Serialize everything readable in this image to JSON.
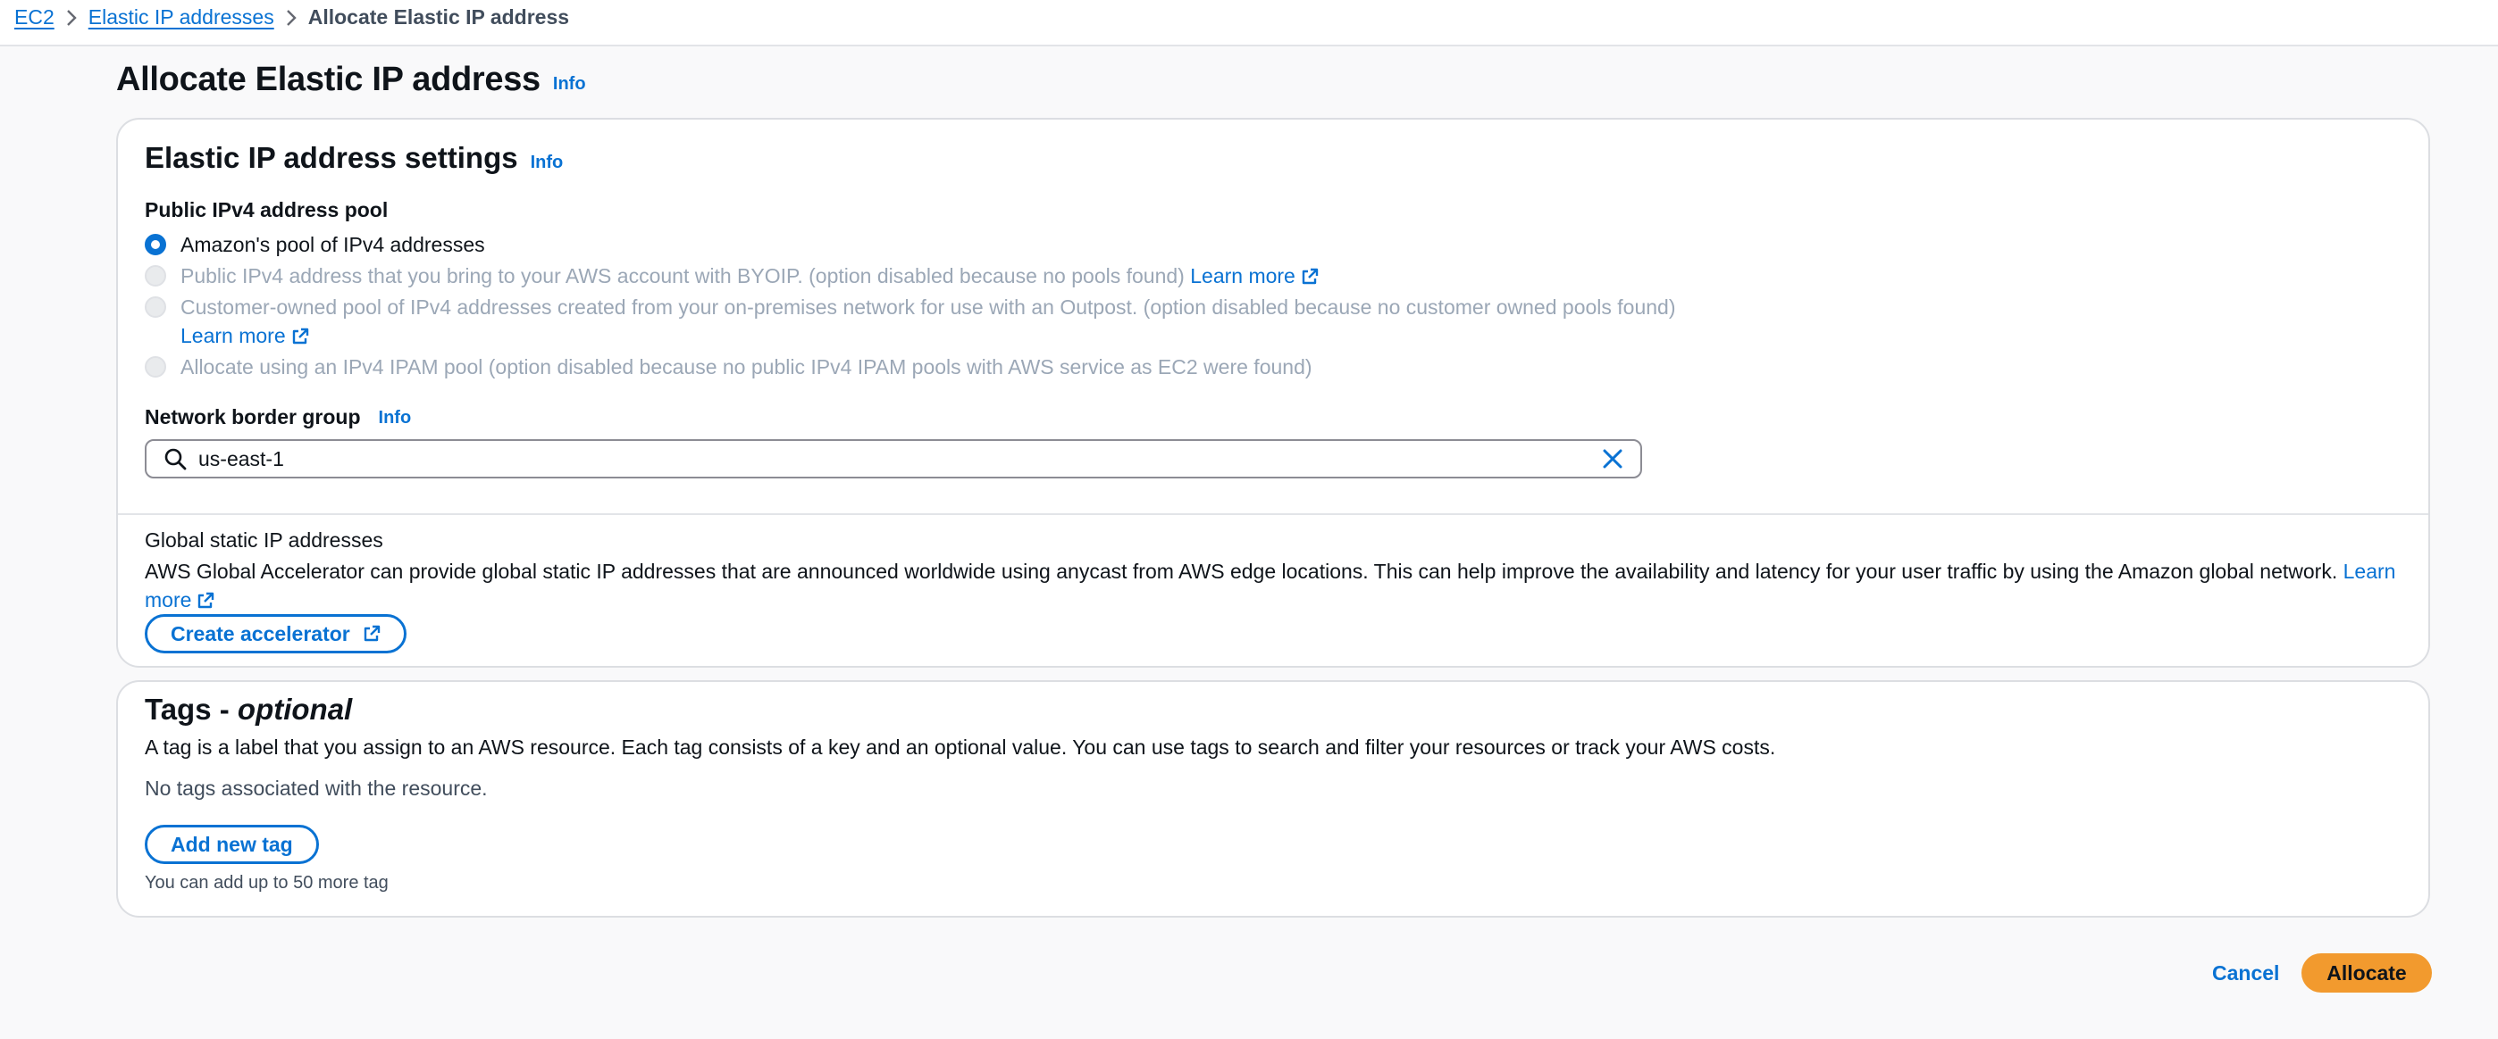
{
  "breadcrumb": {
    "items": [
      "EC2",
      "Elastic IP addresses"
    ],
    "current": "Allocate Elastic IP address"
  },
  "page": {
    "title": "Allocate Elastic IP address",
    "info": "Info"
  },
  "settings": {
    "heading": "Elastic IP address settings",
    "info": "Info",
    "pool_label": "Public IPv4 address pool",
    "options": [
      {
        "label": "Amazon's pool of IPv4 addresses",
        "selected": true,
        "disabled": false
      },
      {
        "label": "Public IPv4 address that you bring to your AWS account with BYOIP. (option disabled because no pools found)",
        "link": "Learn more",
        "selected": false,
        "disabled": true
      },
      {
        "label": "Customer-owned pool of IPv4 addresses created from your on-premises network for use with an Outpost. (option disabled because no customer owned pools found)",
        "link": "Learn more",
        "selected": false,
        "disabled": true
      },
      {
        "label": "Allocate using an IPv4 IPAM pool (option disabled because no public IPv4 IPAM pools with AWS service as EC2 were found)",
        "selected": false,
        "disabled": true
      }
    ],
    "nbg_label": "Network border group",
    "nbg_info": "Info",
    "nbg_value": "us-east-1",
    "global_title": "Global static IP addresses",
    "global_desc": "AWS Global Accelerator can provide global static IP addresses that are announced worldwide using anycast from AWS edge locations. This can help improve the availability and latency for your user traffic by using the Amazon global network.",
    "global_link": "Learn more",
    "create_button": "Create accelerator"
  },
  "tags": {
    "heading_main": "Tags - ",
    "heading_optional": "optional",
    "desc": "A tag is a label that you assign to an AWS resource. Each tag consists of a key and an optional value. You can use tags to search and filter your resources or track your AWS costs.",
    "empty": "No tags associated with the resource.",
    "add_button": "Add new tag",
    "hint": "You can add up to 50 more tag"
  },
  "footer": {
    "cancel": "Cancel",
    "allocate": "Allocate"
  },
  "colors": {
    "link": "#0972d3",
    "primary_button": "#f29a2e",
    "disabled_text": "#9ba7b6"
  },
  "icons": {
    "breadcrumb_separator": "chevron-right-icon",
    "external": "external-link-icon",
    "search": "search-icon",
    "clear": "close-icon"
  }
}
